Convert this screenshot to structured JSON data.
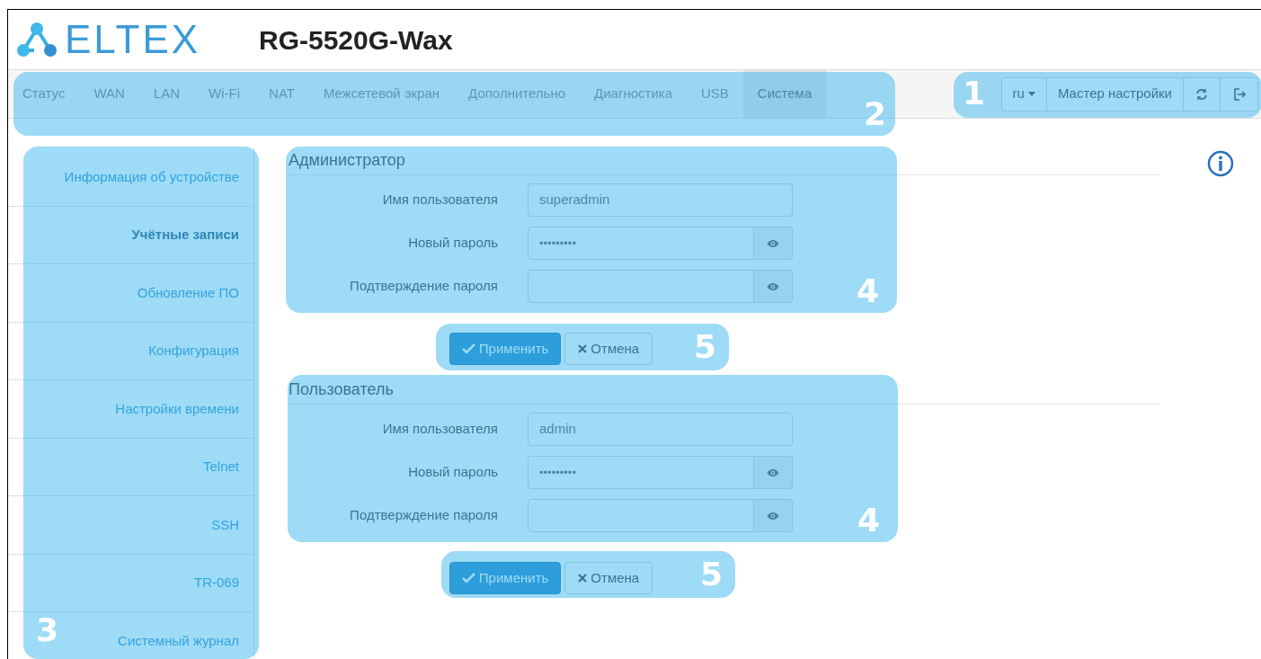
{
  "header": {
    "logo_text": "ELTEX",
    "device_model": "RG-5520G-Wax"
  },
  "nav": [
    {
      "label": "Статус",
      "selected": false
    },
    {
      "label": "WAN",
      "selected": false
    },
    {
      "label": "LAN",
      "selected": false
    },
    {
      "label": "Wi-Fi",
      "selected": false
    },
    {
      "label": "NAT",
      "selected": false
    },
    {
      "label": "Межсетевой экран",
      "selected": false
    },
    {
      "label": "Дополнительно",
      "selected": false
    },
    {
      "label": "Диагностика",
      "selected": false
    },
    {
      "label": "USB",
      "selected": false
    },
    {
      "label": "Система",
      "selected": true
    }
  ],
  "toolbar": {
    "language": "ru",
    "wizard": "Мастер настройки"
  },
  "sidebar": [
    {
      "label": "Информация об устройстве",
      "selected": false
    },
    {
      "label": "Учётные записи",
      "selected": true
    },
    {
      "label": "Обновление ПО",
      "selected": false
    },
    {
      "label": "Конфигурация",
      "selected": false
    },
    {
      "label": "Настройки времени",
      "selected": false
    },
    {
      "label": "Telnet",
      "selected": false
    },
    {
      "label": "SSH",
      "selected": false
    },
    {
      "label": "TR-069",
      "selected": false
    },
    {
      "label": "Системный журнал",
      "selected": false
    }
  ],
  "sections": [
    {
      "title": "Администратор",
      "fields": [
        {
          "label": "Имя пользователя",
          "kind": "text",
          "value": "superadmin"
        },
        {
          "label": "Новый пароль",
          "kind": "password",
          "value": "•••••••••"
        },
        {
          "label": "Подтверждение пароля",
          "kind": "password"
        }
      ],
      "apply": "Применить",
      "cancel": "Отмена"
    },
    {
      "title": "Пользователь",
      "fields": [
        {
          "label": "Имя пользователя",
          "kind": "text",
          "value": "admin"
        },
        {
          "label": "Новый пароль",
          "kind": "password",
          "value": "•••••••••"
        },
        {
          "label": "Подтверждение пароля",
          "kind": "password"
        }
      ],
      "apply": "Применить",
      "cancel": "Отмена"
    }
  ],
  "callouts": [
    {
      "number": "1"
    },
    {
      "number": "2"
    },
    {
      "number": "3"
    },
    {
      "number": "4"
    },
    {
      "number": "5"
    },
    {
      "number": "4"
    },
    {
      "number": "5"
    }
  ]
}
